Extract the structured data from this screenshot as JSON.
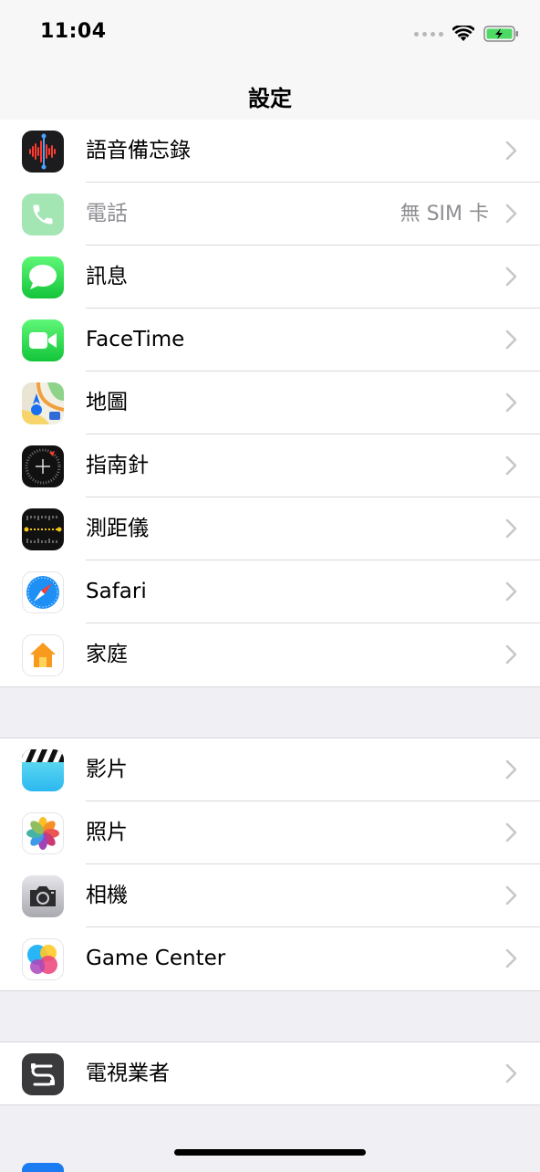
{
  "status_bar": {
    "time": "11:04"
  },
  "nav": {
    "title": "設定"
  },
  "groups": [
    {
      "rows": [
        {
          "label": "語音備忘錄",
          "value": "",
          "icon": "voice-memos-icon"
        },
        {
          "label": "電話",
          "value": "無 SIM 卡",
          "icon": "phone-icon",
          "dim": true
        },
        {
          "label": "訊息",
          "value": "",
          "icon": "messages-icon"
        },
        {
          "label": "FaceTime",
          "value": "",
          "icon": "facetime-icon"
        },
        {
          "label": "地圖",
          "value": "",
          "icon": "maps-icon"
        },
        {
          "label": "指南針",
          "value": "",
          "icon": "compass-icon"
        },
        {
          "label": "測距儀",
          "value": "",
          "icon": "measure-icon"
        },
        {
          "label": "Safari",
          "value": "",
          "icon": "safari-icon"
        },
        {
          "label": "家庭",
          "value": "",
          "icon": "home-app-icon"
        }
      ]
    },
    {
      "rows": [
        {
          "label": "影片",
          "value": "",
          "icon": "tv-videos-icon"
        },
        {
          "label": "照片",
          "value": "",
          "icon": "photos-icon"
        },
        {
          "label": "相機",
          "value": "",
          "icon": "camera-icon"
        },
        {
          "label": "Game Center",
          "value": "",
          "icon": "game-center-icon"
        }
      ]
    },
    {
      "rows": [
        {
          "label": "電視業者",
          "value": "",
          "icon": "tv-provider-icon"
        }
      ]
    }
  ],
  "colors": {
    "background": "#efeff4",
    "chevron": "#c7c7cc",
    "secondary_text": "#8e8e93"
  }
}
